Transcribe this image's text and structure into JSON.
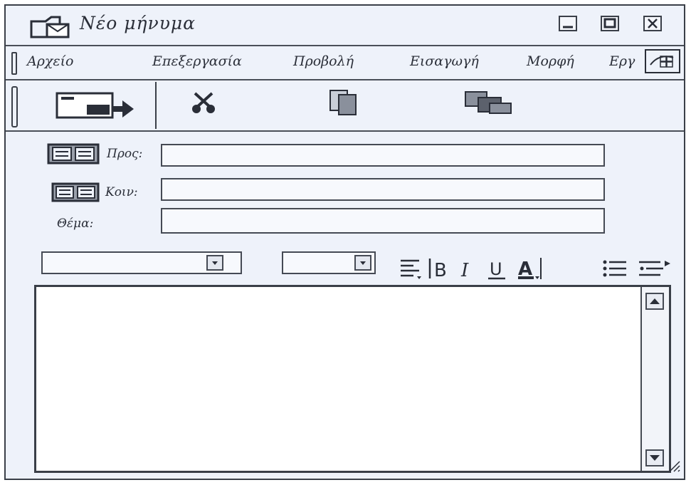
{
  "window": {
    "title": "Νέο μήνυμα"
  },
  "menu": {
    "items": [
      "Αρχείο",
      "Επεξεργασία",
      "Προβολή",
      "Εισαγωγή",
      "Μορφή",
      "Εργ"
    ]
  },
  "fields": {
    "to_label": "Προς:",
    "cc_label": "Κοιν:",
    "subject_label": "Θέμα:"
  },
  "colors": {
    "ink": "#2a2e38",
    "paper": "#eef2fa"
  },
  "icons": [
    "envelope-icon",
    "minimize-icon",
    "maximize-icon",
    "close-icon",
    "send-icon",
    "cut-icon",
    "copy-icon",
    "paste-icon",
    "address-book-icon",
    "align-icon",
    "bold-icon",
    "italic-icon",
    "underline-icon",
    "font-color-icon",
    "bullets-icon",
    "numbering-icon",
    "scroll-up-icon",
    "scroll-down-icon"
  ]
}
